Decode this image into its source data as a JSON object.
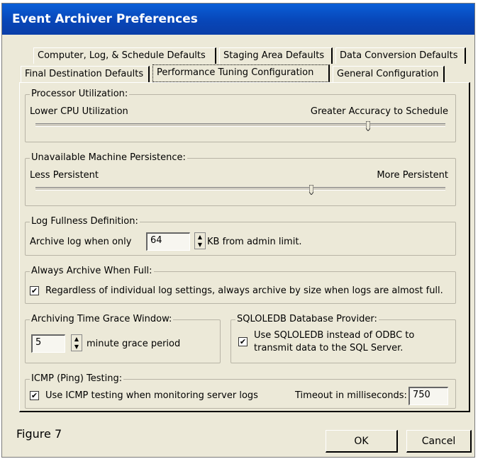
{
  "window": {
    "title": "Event Archiver Preferences"
  },
  "tabs": {
    "row1": [
      "Computer, Log, & Schedule Defaults",
      "Staging Area Defaults",
      "Data Conversion Defaults"
    ],
    "row2": [
      "Final Destination Defaults",
      "Performance Tuning Configuration",
      "General Configuration"
    ],
    "active": "Performance Tuning Configuration"
  },
  "processor": {
    "legend": "Processor Utilization:",
    "left_label": "Lower CPU Utilization",
    "right_label": "Greater Accuracy to Schedule",
    "slider_position": 0.82
  },
  "machine": {
    "legend": "Unavailable Machine Persistence:",
    "left_label": "Less Persistent",
    "right_label": "More Persistent",
    "slider_position": 0.67
  },
  "log_fullness": {
    "legend": "Log Fullness Definition:",
    "prefix": "Archive log when only",
    "value": "64",
    "suffix": "KB from admin limit."
  },
  "always_archive": {
    "legend": "Always Archive When Full:",
    "checked": true,
    "label": "Regardless of individual log settings, always archive by size when logs are almost full."
  },
  "grace": {
    "legend": "Archiving Time Grace Window:",
    "value": "5",
    "suffix": "minute grace period"
  },
  "sqloledb": {
    "legend": "SQLOLEDB Database Provider:",
    "checked": true,
    "label_line1": "Use SQLOLEDB instead of ODBC to",
    "label_line2": "transmit data to the SQL Server."
  },
  "icmp": {
    "legend": "ICMP (Ping) Testing:",
    "checked": true,
    "label": "Use ICMP testing when monitoring server logs",
    "timeout_label": "Timeout in milliseconds:",
    "timeout_value": "750"
  },
  "caption": "Figure 7",
  "buttons": {
    "ok": "OK",
    "cancel": "Cancel"
  }
}
